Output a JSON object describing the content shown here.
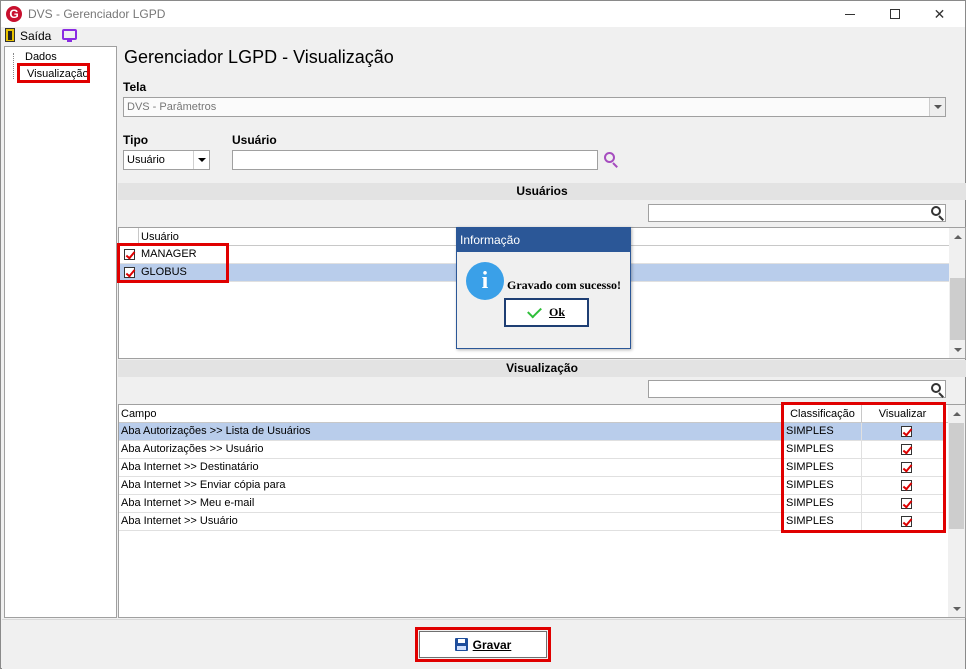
{
  "window": {
    "title": "DVS - Gerenciador LGPD",
    "logo_letter": "G"
  },
  "menu": {
    "exit_label": "Saída"
  },
  "tree": {
    "items": [
      "Dados",
      "Visualização"
    ]
  },
  "page": {
    "title": "Gerenciador LGPD - Visualização"
  },
  "form": {
    "tela_label": "Tela",
    "tela_value": "DVS - Parâmetros",
    "tipo_label": "Tipo",
    "tipo_value": "Usuário",
    "usuario_label": "Usuário",
    "usuario_value": ""
  },
  "users_section": {
    "title": "Usuários",
    "filter_value": "",
    "column": "Usuário",
    "rows": [
      {
        "name": "MANAGER",
        "checked": true,
        "selected": false
      },
      {
        "name": "GLOBUS",
        "checked": true,
        "selected": true
      }
    ]
  },
  "vis_section": {
    "title": "Visualização",
    "filter_value": "",
    "columns": [
      "Campo",
      "Classificação",
      "Visualizar"
    ],
    "rows": [
      {
        "campo": "Aba Autorizações >> Lista de Usuários",
        "classificacao": "SIMPLES",
        "visualizar": true,
        "selected": true
      },
      {
        "campo": "Aba Autorizações >> Usuário",
        "classificacao": "SIMPLES",
        "visualizar": true,
        "selected": false
      },
      {
        "campo": "Aba Internet >> Destinatário",
        "classificacao": "SIMPLES",
        "visualizar": true,
        "selected": false
      },
      {
        "campo": "Aba Internet >> Enviar cópia para",
        "classificacao": "SIMPLES",
        "visualizar": true,
        "selected": false
      },
      {
        "campo": "Aba Internet >> Meu e-mail",
        "classificacao": "SIMPLES",
        "visualizar": true,
        "selected": false
      },
      {
        "campo": "Aba Internet >> Usuário",
        "classificacao": "SIMPLES",
        "visualizar": true,
        "selected": false
      }
    ]
  },
  "dialog": {
    "title": "Informação",
    "icon": "info-icon",
    "message": "Gravado com sucesso!",
    "ok_label": "Ok"
  },
  "footer": {
    "save_label": "Gravar"
  },
  "colors": {
    "highlight_red": "#e00000",
    "dialog_blue": "#2b5797",
    "selection": "#b9cdeb"
  }
}
